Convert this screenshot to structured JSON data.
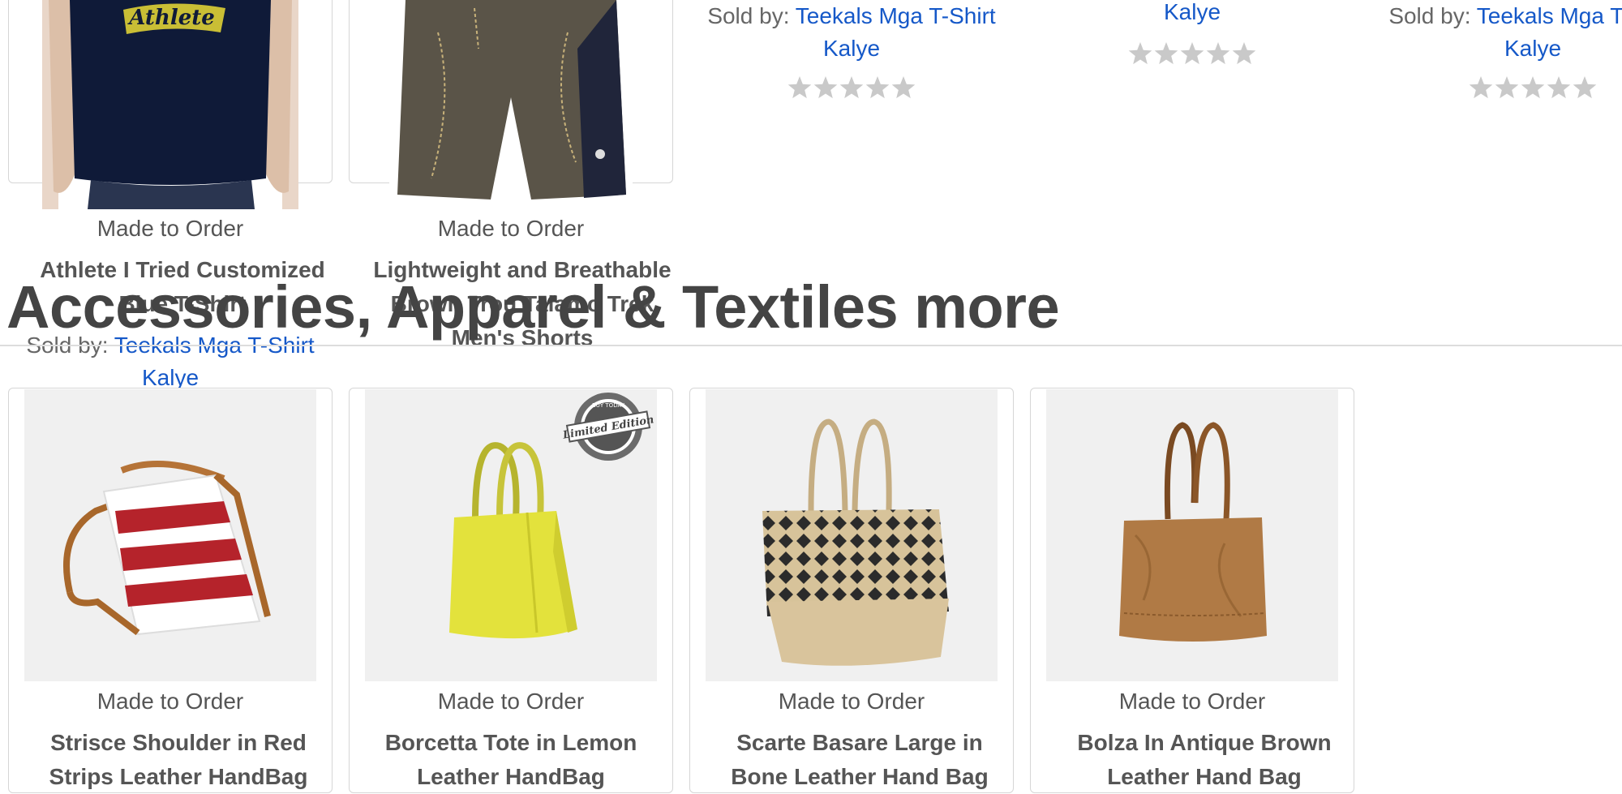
{
  "section": {
    "heading": "Accessories, Apparel & Textiles more"
  },
  "top_row": {
    "tshirt": {
      "status": "Made to Order",
      "title": "Athlete I Tried Customized Blue T-Shirt",
      "sold_by_prefix": "Sold by:",
      "seller_line1": "Teekals Mga T-Shirt",
      "seller_line2": "Kalye",
      "print_text": "Athlete"
    },
    "shorts": {
      "status": "Made to Order",
      "title": "Lightweight and Breathable Brown Trou Talamo Trek Men's Shorts"
    },
    "col3": {
      "sold_by_prefix": "Sold by:",
      "seller_line1": "Teekals Mga T-Shirt",
      "seller_line2": "Kalye",
      "rating": 0
    },
    "col4": {
      "seller_line2": "Kalye",
      "rating": 0
    },
    "col5": {
      "sold_by_prefix": "Sold by:",
      "seller_line1": "Teekals Mga T-Shirt",
      "seller_line2": "Kalye",
      "rating": 0
    }
  },
  "products": [
    {
      "status": "Made to Order",
      "title_line1": "Strisce Shoulder in Red",
      "title_line2": "Strips Leather HandBag"
    },
    {
      "status": "Made to Order",
      "title_line1": "Borcetta Tote in Lemon",
      "title_line2": "Leather HandBag",
      "badge_text": "Limited Edition",
      "badge_top": "BUY TODAY"
    },
    {
      "status": "Made to Order",
      "title_line1": "Scarte Basare Large in",
      "title_line2": "Bone Leather Hand Bag"
    },
    {
      "status": "Made to Order",
      "title_line1": "Bolza In Antique Brown",
      "title_line2": "Leather Hand Bag"
    }
  ],
  "colors": {
    "link": "#1558c8",
    "text": "#555555",
    "heading": "#444444",
    "star": "#c9c9c9",
    "border": "#d6d6d6"
  }
}
